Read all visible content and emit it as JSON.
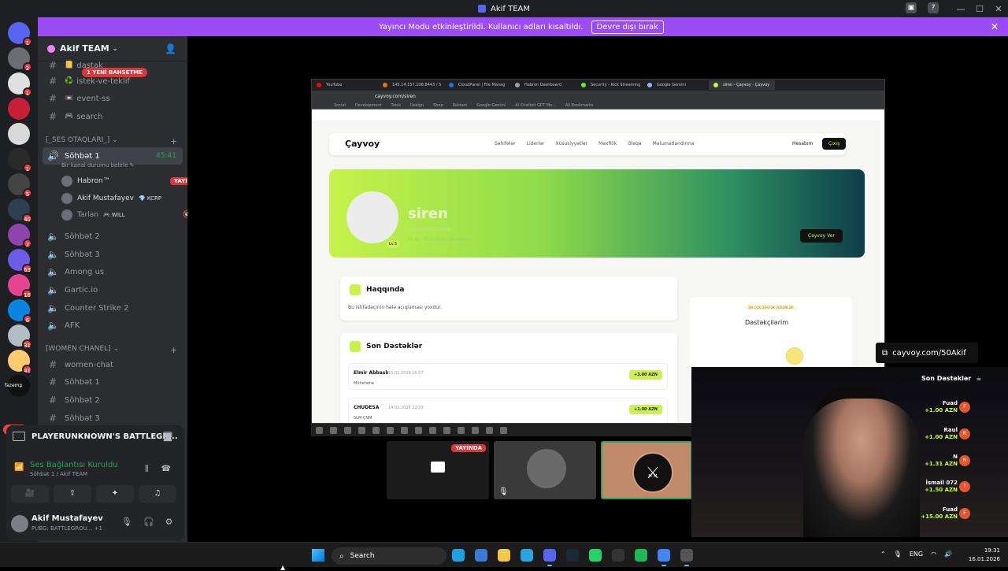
{
  "window": {
    "title": "Akif TEAM"
  },
  "banner": {
    "text": "Yayıncı Modu etkinleştirildi. Kullanıcı adları kısaltıldı.",
    "button": "Devre dışı bırak"
  },
  "servers": [
    {
      "badge": "1",
      "color": "#5865f2",
      "icon": "discord-icon"
    },
    {
      "badge": "2",
      "color": "#6b6d73"
    },
    {
      "badge": "1",
      "color": "#e0e0e0"
    },
    {
      "badge": "",
      "color": "#c71f37"
    },
    {
      "badge": "",
      "color": "#d9d9d9"
    },
    {
      "badge": "1",
      "color": "#2a2a2a"
    },
    {
      "badge": "5",
      "color": "#444"
    },
    {
      "badge": "40",
      "color": "#2c3e50"
    },
    {
      "badge": "2",
      "color": "#8e44ad"
    },
    {
      "badge": "63",
      "color": "#6c5ce7"
    },
    {
      "badge": "16",
      "color": "#e84393"
    },
    {
      "badge": "6",
      "color": "#0984e3"
    },
    {
      "badge": "31",
      "color": "#b2bec3"
    },
    {
      "badge": "41",
      "color": "#fdcb6e"
    },
    {
      "badge": "",
      "color": "#111"
    }
  ],
  "server_misc": {
    "new_label": "YENİ",
    "fazemp_label": "fazemp"
  },
  "server_header": {
    "name": "Akif TEAM"
  },
  "new_messages": "1 YENİ BAHSETME",
  "channels_top": [
    {
      "name": "dastak",
      "emoji": "📒"
    },
    {
      "name": "istek-ve-teklif",
      "emoji": "♻️"
    },
    {
      "name": "event-ss",
      "emoji": "📼"
    },
    {
      "name": "search",
      "emoji": "🎮"
    }
  ],
  "category_voice": "[_SES OTAQLARI_]",
  "voice_active": {
    "name": "Söhbət 1",
    "timer": "45:41",
    "status": "Bir kanal durumu belirle"
  },
  "voice_users": [
    {
      "name": "Habron™",
      "tag": "",
      "live": "YAYINDA"
    },
    {
      "name": "Akif Mustafayev",
      "tag": "💎 KCRP",
      "live": ""
    },
    {
      "name": "Tarlan",
      "tag": "🎮 WILL",
      "live": ""
    }
  ],
  "voice_channels": [
    "Söhbət 2",
    "Söhbət 3",
    "Among us",
    "Gartic.io",
    "Counter Strike 2",
    "AFK"
  ],
  "category_women": "[WOMEN CHANEL]",
  "women_channels": [
    {
      "name": "women-chat",
      "type": "text"
    },
    {
      "name": "Söhbət 1",
      "type": "text"
    },
    {
      "name": "Söhbət 2",
      "type": "text"
    },
    {
      "name": "Söhbət 3",
      "type": "text"
    }
  ],
  "panel": {
    "game": "PLAYERUNKNOWN'S BATTLEGR...",
    "connection": "Ses Bağlantısı Kuruldu",
    "connection_sub": "Söhbət 1 / Akif TEAM",
    "user_name": "Akif Mustafayev",
    "user_status": "PUBG: BATTLEGROU...",
    "user_extra": "+1"
  },
  "browser": {
    "tabs": [
      {
        "title": "YouTube",
        "color": "#ff0000"
      },
      {
        "title": "145.14.157.108:8443 / S",
        "color": "#e8710a"
      },
      {
        "title": "CloudPanel | File Manag",
        "color": "#1a73e8"
      },
      {
        "title": "Habron Dashboard",
        "color": "#9aa0a6"
      },
      {
        "title": "Security - Kick Streaming",
        "color": "#53fc18"
      },
      {
        "title": "Google Gemini",
        "color": "#8ab4f8"
      },
      {
        "title": "siren - Çayvoy - Çayvoy",
        "color": "#c6f24a"
      }
    ],
    "url": "cayvoy.com/siren",
    "bookmarks": [
      "Social",
      "Development",
      "Tools",
      "Design",
      "Shop",
      "Reklam",
      "Google Gemini",
      "AI Chatbot GPT Mo...",
      "All Bookmarks"
    ]
  },
  "site": {
    "logo": "Çayvoy",
    "nav": [
      "Səhifələr",
      "Liderlər",
      "Xüsusiyyətlər",
      "Məxfilik",
      "Əlaqə",
      "Məlumatlandırma"
    ],
    "login": "Hesabım",
    "logout": "Çıxış",
    "profile": {
      "name": "siren",
      "handle": "Hiroz Abbasova",
      "meta": "14 ilə · 15.01.2026 · 28 dəstəkçi",
      "level": "Lv.5",
      "button": "Çayvoy Ver"
    },
    "about": {
      "title": "Haqqında",
      "text": "Bu istifadəçinin hələ açıqlaması yoxdur."
    },
    "recent": {
      "title": "Son Dəstəklər",
      "items": [
        {
          "name": "Elmir Abbaslı",
          "date": "15.01.2026 16:07",
          "msg": "Mühehehe",
          "amount": "+3.00 AZN"
        },
        {
          "name": "CHUDESA",
          "date": "14.01.2026 22:53",
          "msg": "SLM CNM",
          "amount": "+1.00 AZN"
        }
      ]
    },
    "supporters": {
      "label": "ƏN ÇOX DƏSTƏK VERƏNLƏR",
      "title": "Dəstəkçilərim"
    }
  },
  "stream_tiles": {
    "live": "YAYINDA"
  },
  "overlay": {
    "link": "cayvoy.com/50Akif",
    "title": "Son Dəstəklər",
    "donations": [
      {
        "name": "Fuad",
        "amount": "+1.00 AZN",
        "initial": "F"
      },
      {
        "name": "Raul",
        "amount": "+1.00 AZN",
        "initial": "R"
      },
      {
        "name": "N",
        "amount": "+1.31 AZN",
        "initial": "N"
      },
      {
        "name": "İsmail 072",
        "amount": "+1.50 AZN",
        "initial": "İ"
      },
      {
        "name": "Fuad",
        "amount": "+15.00 AZN",
        "initial": "F"
      }
    ]
  },
  "taskbar": {
    "search": "Search",
    "apps": [
      {
        "icon": "edge-icon",
        "color": "#1fa0e0"
      },
      {
        "icon": "store-icon",
        "color": "#3a7bd5"
      },
      {
        "icon": "explorer-icon",
        "color": "#f2c94c"
      },
      {
        "icon": "telegram-icon",
        "color": "#2aa3df"
      },
      {
        "icon": "discord-icon",
        "color": "#5865f2"
      },
      {
        "icon": "steam-icon",
        "color": "#1b2838"
      },
      {
        "icon": "whatsapp-icon",
        "color": "#25d366"
      },
      {
        "icon": "epic-icon",
        "color": "#333"
      },
      {
        "icon": "spotify-icon",
        "color": "#1db954"
      },
      {
        "icon": "chrome-icon",
        "color": "#4285f4"
      },
      {
        "icon": "obs-icon",
        "color": "#555"
      }
    ],
    "lang": "ENG",
    "time": "19:31",
    "date": "16.01.2026"
  }
}
